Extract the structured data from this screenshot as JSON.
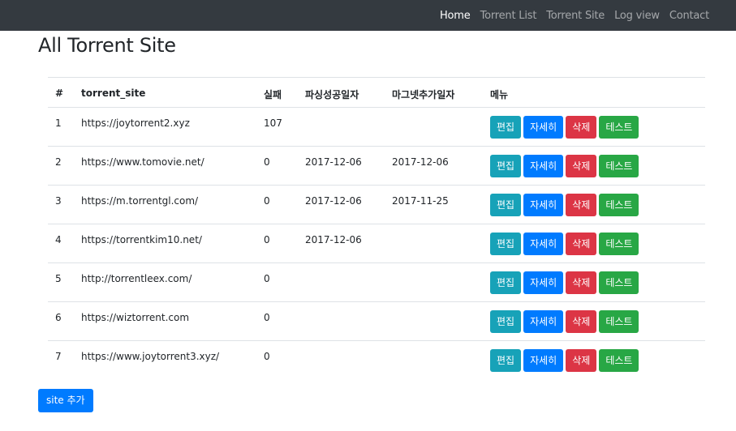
{
  "nav": {
    "items": [
      {
        "label": "Home",
        "active": true
      },
      {
        "label": "Torrent List",
        "active": false
      },
      {
        "label": "Torrent Site",
        "active": false
      },
      {
        "label": "Log view",
        "active": false
      },
      {
        "label": "Contact",
        "active": false
      }
    ]
  },
  "page": {
    "title": "All Torrent Site"
  },
  "table": {
    "headers": {
      "num": "#",
      "site": "torrent_site",
      "fail": "실패",
      "parse_date": "파싱성공일자",
      "magnet_date": "마그넷추가일자",
      "menu": "메뉴"
    },
    "buttons": {
      "edit": "편집",
      "detail": "자세히",
      "delete": "삭제",
      "test": "테스트"
    },
    "rows": [
      {
        "num": "1",
        "site": "https://joytorrent2.xyz",
        "fail": "107",
        "parse_date": "",
        "magnet_date": ""
      },
      {
        "num": "2",
        "site": "https://www.tomovie.net/",
        "fail": "0",
        "parse_date": "2017-12-06",
        "magnet_date": "2017-12-06"
      },
      {
        "num": "3",
        "site": "https://m.torrentgl.com/",
        "fail": "0",
        "parse_date": "2017-12-06",
        "magnet_date": "2017-11-25"
      },
      {
        "num": "4",
        "site": "https://torrentkim10.net/",
        "fail": "0",
        "parse_date": "2017-12-06",
        "magnet_date": ""
      },
      {
        "num": "5",
        "site": "http://torrentleex.com/",
        "fail": "0",
        "parse_date": "",
        "magnet_date": ""
      },
      {
        "num": "6",
        "site": "https://wiztorrent.com",
        "fail": "0",
        "parse_date": "",
        "magnet_date": ""
      },
      {
        "num": "7",
        "site": "https://www.joytorrent3.xyz/",
        "fail": "0",
        "parse_date": "",
        "magnet_date": ""
      }
    ]
  },
  "add_button": {
    "label": "site 추가"
  },
  "colors": {
    "navbar": "#343a40",
    "edit": "#17a2b8",
    "detail": "#007bff",
    "delete": "#dc3545",
    "test": "#28a745"
  }
}
